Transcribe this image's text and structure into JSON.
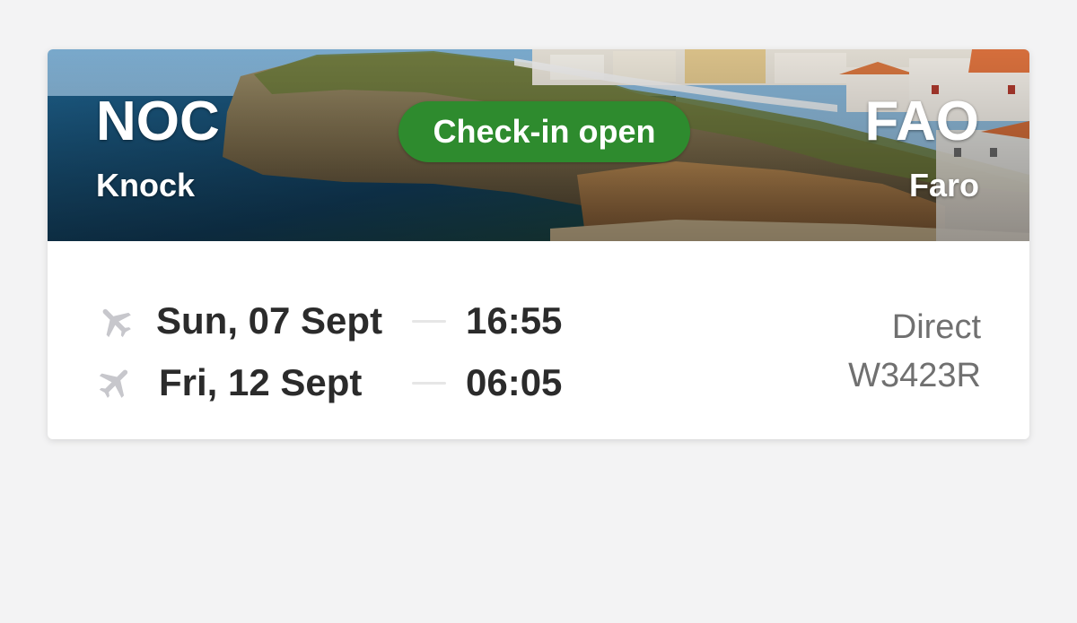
{
  "booking_card": {
    "origin": {
      "code": "NOC",
      "city": "Knock"
    },
    "destination": {
      "code": "FAO",
      "city": "Faro"
    },
    "status_badge": "Check-in open",
    "outbound": {
      "icon": "plane-departure-icon",
      "date": "Sun, 07 Sept",
      "time": "16:55"
    },
    "return": {
      "icon": "plane-arrival-icon",
      "date": "Fri, 12 Sept",
      "time": "06:05"
    },
    "flight_type": "Direct",
    "booking_reference": "W3423R"
  },
  "colors": {
    "badge_green": "#2e8b2e",
    "primary_text": "#2b2b2b",
    "secondary_text": "#707070",
    "icon_grey": "#c7c7cc",
    "page_background": "#f3f3f4"
  }
}
